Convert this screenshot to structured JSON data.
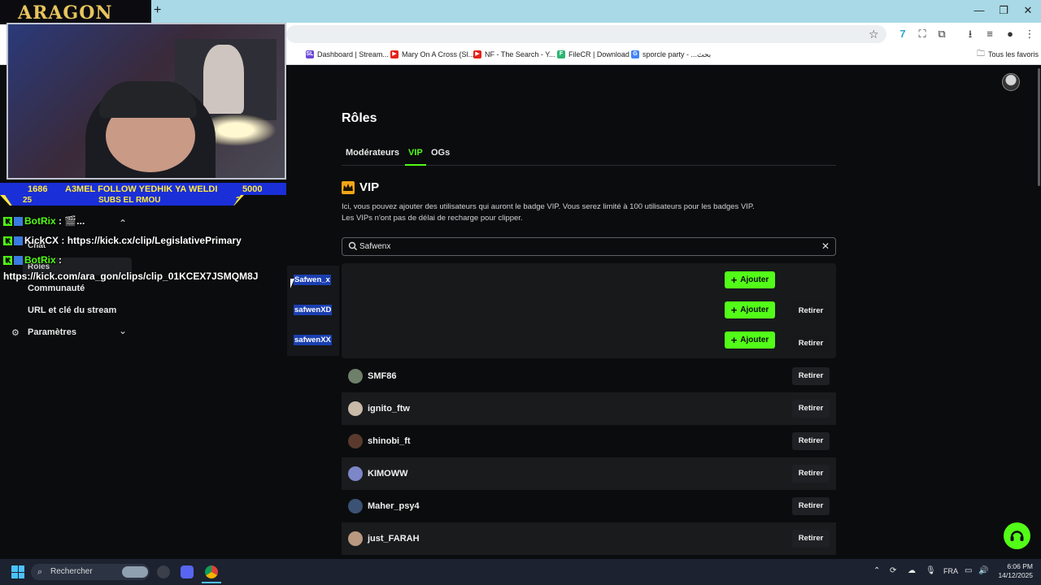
{
  "browser": {
    "new_tab": "+",
    "window_controls": {
      "minimize": "—",
      "maximize": "❐",
      "close": "✕"
    },
    "bookmarks": [
      {
        "label": "Dashboard | Stream...",
        "badge": "SL",
        "color": "#6c4ad8"
      },
      {
        "label": "Mary On A Cross (Sl...",
        "badge": "▶",
        "color": "#e62117"
      },
      {
        "label": "NF - The Search - Y...",
        "badge": "▶",
        "color": "#e62117"
      },
      {
        "label": "FileCR | Download",
        "badge": "F",
        "color": "#2bb673"
      },
      {
        "label": "sporcle party - ...بحث",
        "badge": "G",
        "color": "#4285f4"
      }
    ],
    "all_favorites": "Tous les favoris"
  },
  "sidebar": {
    "chat": "Chat",
    "roles": "Rôles",
    "community": "Communauté",
    "stream_url": "URL et clé du stream",
    "settings": "Paramètres"
  },
  "main": {
    "title": "Rôles",
    "tabs": [
      "Modérateurs",
      "VIP",
      "OGs"
    ],
    "active_tab": "VIP",
    "section_title": "VIP",
    "description_line1": "Ici, vous pouvez ajouter des utilisateurs qui auront le badge VIP. Vous serez limité à 100 utilisateurs pour les badges VIP.",
    "description_line2": "Les VIPs n'ont pas de délai de recharge pour clipper.",
    "search_value": "Safwenx",
    "add_label": "Ajouter",
    "remove_label": "Retirer",
    "suggestions": [
      "Safwen_x",
      "safwenXD",
      "safwenXX"
    ],
    "users": [
      {
        "name": "SMF86",
        "avatar_color": "#6e7f6a"
      },
      {
        "name": "ignito_ftw",
        "avatar_color": "#c8b9a8"
      },
      {
        "name": "shinobi_ft",
        "avatar_color": "#5a3a2e"
      },
      {
        "name": "KIMOWW",
        "avatar_color": "#7d86c8"
      },
      {
        "name": "Maher_psy4",
        "avatar_color": "#3b5275"
      },
      {
        "name": "just_FARAH",
        "avatar_color": "#b89880"
      }
    ]
  },
  "overlay": {
    "logo": "ARAGON",
    "banner_left": "1686",
    "banner_text": "A3MEL FOLLOW YEDHIK YA WELDI",
    "banner_right": "5000",
    "sub_left": "25",
    "sub_text": "SUBS EL RMOU",
    "sub_right": "25",
    "chat": [
      {
        "user": "BotRix",
        "message": "🎬..."
      },
      {
        "user": "KickCX",
        "message": "https://kick.cx/clip/LegislativePrimary"
      },
      {
        "user": "BotRix",
        "message": ""
      }
    ],
    "chat_link": "https://kick.com/ara_gon/clips/clip_01KCEX7JSMQM8J"
  },
  "taskbar": {
    "search_placeholder": "Rechercher",
    "lang": "FRA",
    "time": "6:06 PM",
    "date": "14/12/2025"
  }
}
